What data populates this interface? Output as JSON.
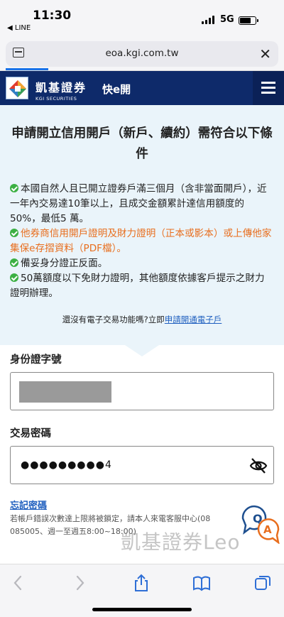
{
  "status_bar": {
    "time": "11:30",
    "back_app": "◀ LINE",
    "network": "5G"
  },
  "browser": {
    "url": "eoa.kgi.com.tw"
  },
  "site_header": {
    "brand_cn": "凱基證券",
    "brand_en": "KGI SECURITIES",
    "quick_open": "快e開"
  },
  "notice": {
    "title": "申請開立信用開戶（新戶、續約）需符合以下條件",
    "requirements": [
      {
        "text": "本國自然人且已開立證券戶滿三個月（含非當面開戶），近一年內交易達10筆以上，且成交金額累計達信用額度的50%，最低5 萬。",
        "color": "#222222"
      },
      {
        "text": "他券商信用開戶證明及財力證明（正本或影本）或上傳他家集保e存摺資料（PDF檔）。",
        "color": "#e86e1e"
      },
      {
        "text": "備妥身分證正反面。",
        "color": "#222222"
      },
      {
        "text": "50萬額度以下免財力證明，其他額度依據客戶提示之財力證明辦理。",
        "color": "#222222"
      }
    ],
    "eopen_prompt": "還沒有電子交易功能嗎?立即",
    "eopen_link": "申請開通電子戶"
  },
  "form": {
    "id_label": "身份證字號",
    "password_label": "交易密碼",
    "password_value": "●●●●●●●●●4",
    "forgot_label": "忘記密碼",
    "lock_info": "若帳戶錯誤次數達上限將被鎖定，請本人來電客服中心(08 085005、週一至週五8:00~18:00)"
  },
  "qa_bubble": {
    "q": "Q",
    "a": "A"
  },
  "watermark": "凱基證券Leo",
  "colors": {
    "navy": "#0e2a6a",
    "light_blue": "#eaf4fa",
    "link": "#1f5fbf",
    "orange": "#e86e1e",
    "check_green": "#3cb043"
  }
}
